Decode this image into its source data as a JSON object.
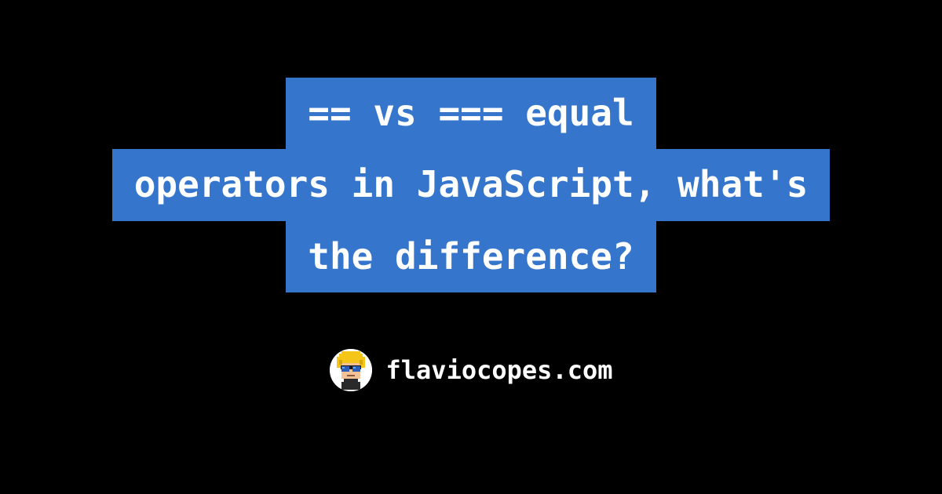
{
  "title": {
    "lines": [
      "== vs === equal",
      "operators in JavaScript, what's",
      "the difference?"
    ]
  },
  "footer": {
    "site": "flaviocopes.com",
    "avatar_name": "avatar"
  },
  "colors": {
    "background": "#000000",
    "highlight": "#3576CC",
    "text": "#ffffff"
  }
}
